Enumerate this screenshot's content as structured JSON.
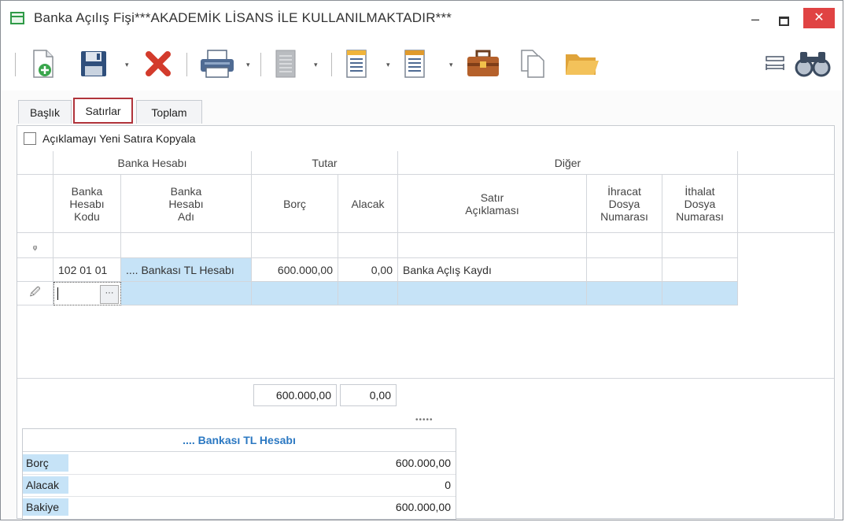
{
  "window": {
    "title": "Banka Açılış Fişi***AKADEMİK LİSANS İLE KULLANILMAKTADIR***",
    "minimize": "–",
    "close": "✕"
  },
  "toolbar": {
    "icons": [
      "new-document-icon",
      "save-icon",
      "delete-icon",
      "print-icon",
      "disabled-document-icon",
      "document-lines-icon",
      "document-list-icon",
      "briefcase-icon",
      "copy-icon",
      "folder-icon",
      "resize-columns-icon",
      "binoculars-icon"
    ],
    "drop": "▾"
  },
  "tabs": [
    {
      "label": "Başlık"
    },
    {
      "label": "Satırlar",
      "active": true
    },
    {
      "label": "Toplam"
    }
  ],
  "checkbox": {
    "label": "Açıklamayı Yeni Satıra Kopyala",
    "checked": false
  },
  "grid": {
    "groups": {
      "bank_account": "Banka Hesabı",
      "amount": "Tutar",
      "other": "Diğer"
    },
    "columns": {
      "code": "Banka\nHesabı\nKodu",
      "name": "Banka\nHesabı\nAdı",
      "debit": "Borç",
      "credit": "Alacak",
      "desc": "Satır\nAçıklaması",
      "export": "İhracat\nDosya\nNumarası",
      "import": "İthalat\nDosya\nNumarası"
    },
    "filter_icon": "ᵩ",
    "rows": [
      {
        "code": "102 01 01",
        "name": ".... Bankası TL Hesabı",
        "debit": "600.000,00",
        "credit": "0,00",
        "desc": "Banka Açlış Kaydı",
        "export": "",
        "import": ""
      }
    ],
    "edit_row": {
      "indicator": "🖉",
      "ellipsis": "···"
    },
    "totals": {
      "debit": "600.000,00",
      "credit": "0,00"
    }
  },
  "splitter": "•••••",
  "summary": {
    "title": ".... Bankası TL Hesabı",
    "rows": [
      {
        "label": "Borç",
        "value": "600.000,00"
      },
      {
        "label": "Alacak",
        "value": "0"
      },
      {
        "label": "Bakiye",
        "value": "600.000,00"
      }
    ]
  },
  "colors": {
    "accent": "#2b78c2",
    "selection": "#c6e3f7",
    "close": "#e04343",
    "tab_highlight": "#b0333a"
  }
}
